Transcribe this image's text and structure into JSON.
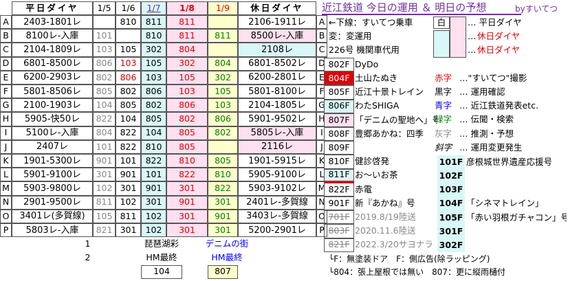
{
  "header": {
    "weekday_title": "平日ダイヤ",
    "dates": [
      "1/5",
      "1/6",
      "1/7",
      "1/8",
      "1/9"
    ],
    "holiday_title": "休日ダイヤ",
    "page_title": "近江鉄道 今日の運用 ＆ 明日の予想",
    "by": "byすいてつ"
  },
  "rows": [
    {
      "id": "A",
      "wk": "2403-1801レ",
      "d": [
        "",
        "810",
        "811",
        "811",
        ""
      ],
      "hol": "2106-1911レ"
    },
    {
      "id": "B",
      "wk": "8100レ-入庫",
      "d": [
        "101",
        "",
        "810",
        "811",
        "811"
      ],
      "hol": "8500レ-入庫"
    },
    {
      "id": "C",
      "wk": "2104-1809レ",
      "d": [
        "103",
        "105",
        "302",
        "804",
        ""
      ],
      "hol": "2108レ"
    },
    {
      "id": "D",
      "wk": "6801-8500レ",
      "d": [
        "806",
        "103",
        "105",
        "302",
        "804"
      ],
      "hol": "6801-8502レ"
    },
    {
      "id": "E",
      "wk": "6200-2903レ",
      "d": [
        "802",
        "806",
        "103",
        "105",
        "302"
      ],
      "hol": "6200-2801レ"
    },
    {
      "id": "F",
      "wk": "5801-8506レ",
      "d": [
        "805",
        "802",
        "806",
        "103",
        "105"
      ],
      "hol": "5801-8100レ"
    },
    {
      "id": "G",
      "wk": "2100-1903レ",
      "d": [
        "104",
        "805",
        "802",
        "806",
        "103"
      ],
      "hol": "2104-1805レ"
    },
    {
      "id": "H",
      "wk": "5905-快50レ",
      "d": [
        "822",
        "104",
        "805",
        "802",
        "806"
      ],
      "hol": "5901-9502レ"
    },
    {
      "id": "I",
      "wk": "5100レ-入庫",
      "d": [
        "804",
        "822",
        "104",
        "805",
        "802"
      ],
      "hol": "5805レ-入庫"
    },
    {
      "id": "J",
      "wk": "2407レ",
      "d": [
        "101",
        "822",
        "810",
        "805",
        ""
      ],
      "hol": "2116レ"
    },
    {
      "id": "K",
      "wk": "1901-5300レ",
      "d": [
        "901",
        "101",
        "822",
        "810",
        "805"
      ],
      "hol": "1901-5915レ"
    },
    {
      "id": "L",
      "wk": "5901-9100レ",
      "d": [
        "301",
        "901",
        "101",
        "822",
        "810"
      ],
      "hol": "5905-9100レ"
    },
    {
      "id": "M",
      "wk": "5903-9800レ",
      "d": [
        "102",
        "301",
        "901",
        "301",
        "822"
      ],
      "hol": "5903-9102レ"
    },
    {
      "id": "N",
      "wk": "2901-9500レ",
      "d": [
        "811",
        "102",
        "301",
        "901",
        "301"
      ],
      "hol": "2401レ-多賀線"
    },
    {
      "id": "O",
      "wk": "3401レ(多賀線)",
      "d": [
        "105",
        "811",
        "102",
        "301",
        "901"
      ],
      "hol": "3403レ-多賀線"
    },
    {
      "id": "P",
      "wk": "5803レ-入庫",
      "d": [
        "821",
        "301",
        "102",
        "301",
        "301"
      ],
      "hol": "5200-2901レ"
    }
  ],
  "extra_rows": [
    {
      "label": "1",
      "biwako": "琵琶湖彩",
      "denim": "デニムの街"
    },
    {
      "label": "2",
      "biwako": "HM最終",
      "denim": "HM最終",
      "v1": "104",
      "v2": "807"
    }
  ],
  "legend": {
    "l1": "←下線：すいてつ乗車",
    "l2": "変：変運用",
    "l3": "226号 機関車代用",
    "w": "白",
    "w_t": "… 平日ダイヤ",
    "p_t1": "… ",
    "p_t2": "休日ダイヤ",
    "c_t1": "… ",
    "c_t2": "休日ダイヤ",
    "red_k": "赤字",
    "red_v": "…\"すいてつ\"撮影",
    "black_k": "黒字",
    "black_v": "… 運用確認",
    "blue_k": "青字",
    "blue_v": "… 近江鉄道発表etc.",
    "green_k": "緑字",
    "green_v": "… 伝聞・検索",
    "gray_k": "灰字",
    "gray_v": "… 推測・予想",
    "ital_k": "斜字",
    "ital_v": "… 運用変更発生"
  },
  "cars": [
    {
      "n": "802F",
      "d": "DyDo"
    },
    {
      "n": "804F",
      "d": "土山たぬき"
    },
    {
      "n": "805F",
      "d": "近江十景トレイン"
    },
    {
      "n": "806F",
      "d": "わたSHIGA"
    },
    {
      "n": "807F",
      "d": "「デニムの聖地へ」号"
    },
    {
      "n": "808F",
      "d": "豊郷あかね：四季"
    },
    {
      "n": "809F",
      "d": ""
    },
    {
      "n": "810F",
      "d": "健診啓発"
    },
    {
      "n": "811F",
      "d": "お～いお茶"
    },
    {
      "n": "822F",
      "d": "赤電"
    },
    {
      "n": "901F",
      "d": "新『あかね』号"
    },
    {
      "n": "701F",
      "d": "2019.8/19陸送"
    },
    {
      "n": "803F",
      "d": "2020.11.6陸送"
    },
    {
      "n": "821F",
      "d": "2022.3/20サヨナラ"
    }
  ],
  "cars2": [
    {
      "n": "101F",
      "d": "彦根城世界遺産応援号"
    },
    {
      "n": "102F",
      "d": ""
    },
    {
      "n": "103F",
      "d": ""
    },
    {
      "n": "104F",
      "d": "「シネマトレイン」"
    },
    {
      "n": "105F",
      "d": "「赤い羽根ガチャコン」号"
    },
    {
      "n": "301F",
      "d": ""
    },
    {
      "n": "302F",
      "d": ""
    }
  ],
  "notes": {
    "n1": "└F：無塗装ドア　F：側広告(除ラッピング)",
    "n2": "└804：張上屋根では無い　807：更に縦雨樋付"
  },
  "colors": {
    "weekday": "#ffffff",
    "holiday_pink": "#ffe0f0",
    "holiday_cyan": "#d9f7f7",
    "holiday_yellow": "#ffffcc",
    "title_purple": "#7030a0",
    "red": "#e00000",
    "blue": "#0000ff",
    "green": "#008000",
    "gray": "#888888"
  }
}
